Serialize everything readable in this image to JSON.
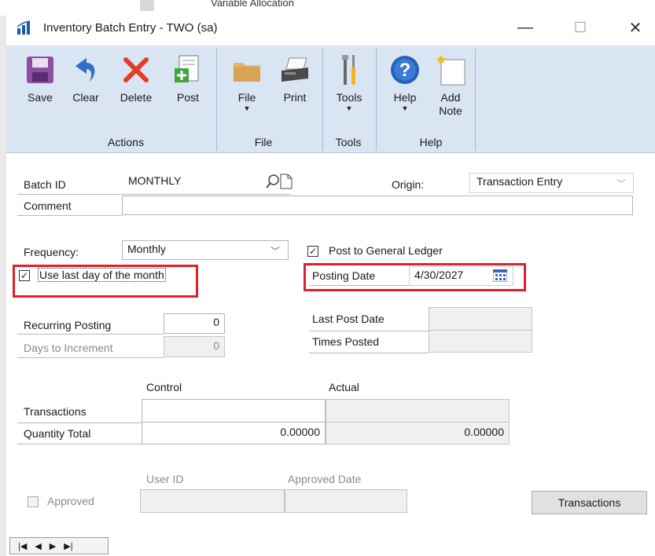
{
  "background": {
    "window_title_peek": "Variable Allocation"
  },
  "window": {
    "title": "Inventory Batch Entry  -  TWO (sa)",
    "minimize": "—",
    "maximize": "☐",
    "close": "✕"
  },
  "ribbon": {
    "groups": [
      {
        "label": "Actions",
        "buttons": [
          "Save",
          "Clear",
          "Delete",
          "Post"
        ]
      },
      {
        "label": "File",
        "buttons": [
          "File",
          "Print"
        ]
      },
      {
        "label": "Tools",
        "buttons": [
          "Tools"
        ]
      },
      {
        "label": "Help",
        "buttons": [
          "Help",
          "Add Note"
        ]
      }
    ],
    "save": "Save",
    "clear": "Clear",
    "delete": "Delete",
    "post": "Post",
    "file": "File",
    "print": "Print",
    "tools": "Tools",
    "help": "Help",
    "add_note_1": "Add",
    "add_note_2": "Note",
    "group_actions": "Actions",
    "group_file": "File",
    "group_tools": "Tools",
    "group_help": "Help"
  },
  "form": {
    "batch_id_label": "Batch ID",
    "batch_id_value": "MONTHLY",
    "origin_label": "Origin:",
    "origin_value": "Transaction Entry",
    "comment_label": "Comment",
    "comment_value": "",
    "frequency_label": "Frequency:",
    "frequency_value": "Monthly",
    "post_to_gl_label": "Post to General Ledger",
    "post_to_gl_checked": true,
    "use_last_day_label": "Use last day of the month",
    "use_last_day_checked": true,
    "posting_date_label": "Posting Date",
    "posting_date_value": "4/30/2027",
    "recurring_posting_label": "Recurring Posting",
    "recurring_posting_value": "0",
    "days_to_increment_label": "Days to Increment",
    "days_to_increment_value": "0",
    "last_post_date_label": "Last Post Date",
    "last_post_date_value": "",
    "times_posted_label": "Times Posted",
    "times_posted_value": "",
    "control_header": "Control",
    "actual_header": "Actual",
    "transactions_label": "Transactions",
    "transactions_control": "",
    "transactions_actual": "",
    "quantity_total_label": "Quantity Total",
    "quantity_total_control": "0.00000",
    "quantity_total_actual": "0.00000",
    "user_id_header": "User ID",
    "approved_date_header": "Approved Date",
    "approved_label": "Approved",
    "approved_checked": false,
    "transactions_button": "Transactions"
  },
  "colors": {
    "ribbon_bg": "#d9e5f3",
    "highlight_red": "#e0202a"
  }
}
